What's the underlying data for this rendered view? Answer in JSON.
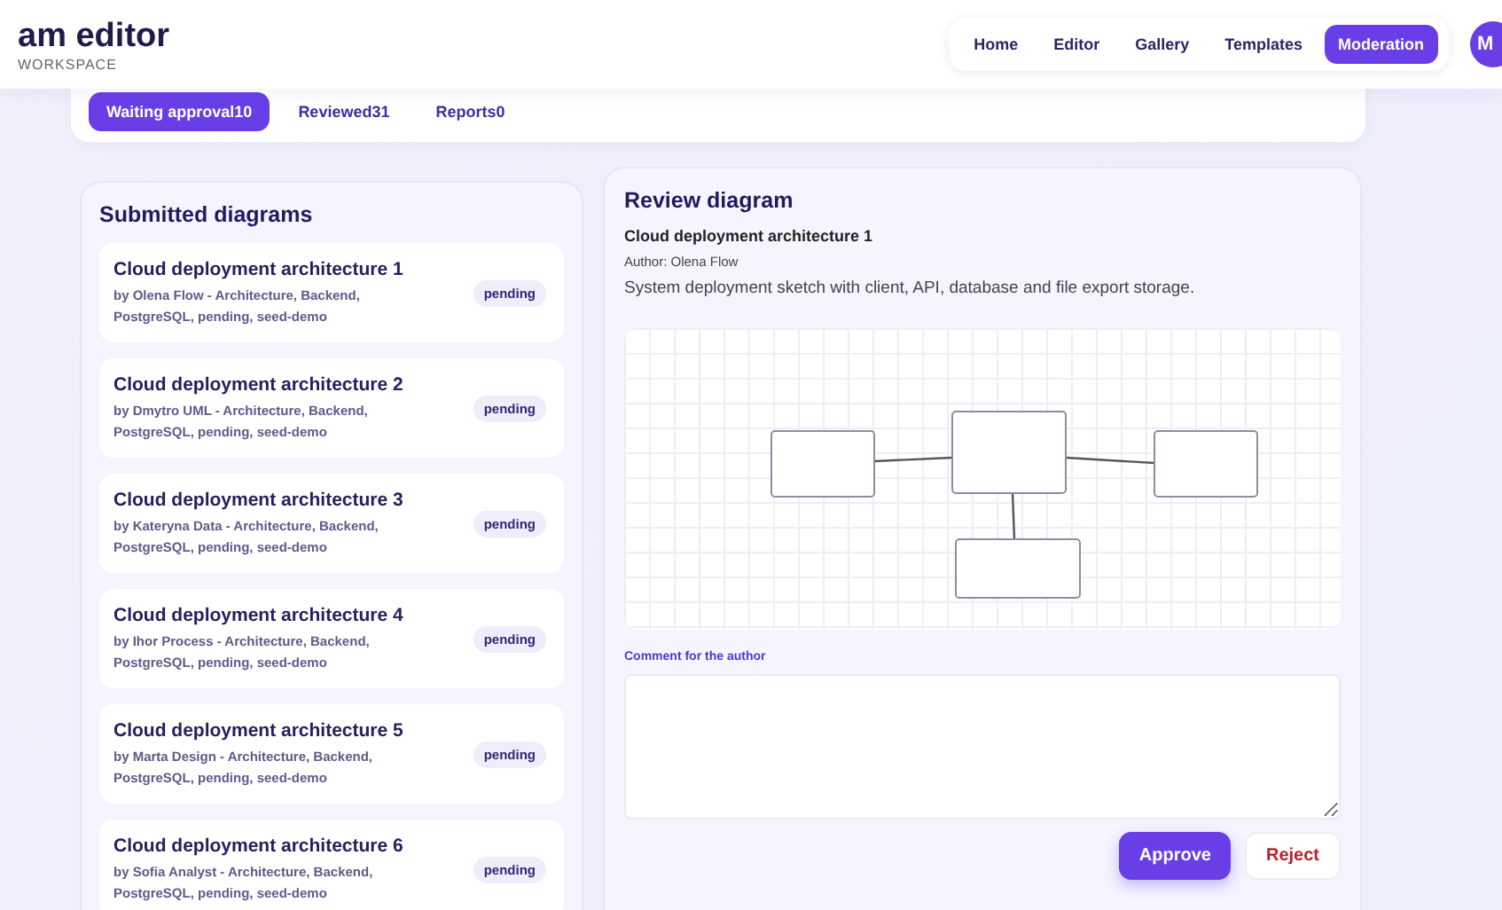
{
  "brand": {
    "title": "am editor",
    "subtitle": "WORKSPACE"
  },
  "nav": [
    {
      "label": "Home",
      "selected": false
    },
    {
      "label": "Editor",
      "selected": false
    },
    {
      "label": "Gallery",
      "selected": false
    },
    {
      "label": "Templates",
      "selected": false
    },
    {
      "label": "Moderation",
      "selected": true
    }
  ],
  "avatar": "M",
  "tabs": [
    {
      "label": "Waiting approval",
      "count": "10",
      "selected": true
    },
    {
      "label": "Reviewed",
      "count": "31",
      "selected": false
    },
    {
      "label": "Reports",
      "count": "0",
      "selected": false
    }
  ],
  "submitted": {
    "title": "Submitted diagrams",
    "items": [
      {
        "title": "Cloud deployment architecture 1",
        "meta": "by Olena Flow - Architecture, Backend, PostgreSQL, pending, seed-demo",
        "status": "pending"
      },
      {
        "title": "Cloud deployment architecture 2",
        "meta": "by Dmytro UML - Architecture, Backend, PostgreSQL, pending, seed-demo",
        "status": "pending"
      },
      {
        "title": "Cloud deployment architecture 3",
        "meta": "by Kateryna Data - Architecture, Backend, PostgreSQL, pending, seed-demo",
        "status": "pending"
      },
      {
        "title": "Cloud deployment architecture 4",
        "meta": "by Ihor Process - Architecture, Backend, PostgreSQL, pending, seed-demo",
        "status": "pending"
      },
      {
        "title": "Cloud deployment architecture 5",
        "meta": "by Marta Design - Architecture, Backend, PostgreSQL, pending, seed-demo",
        "status": "pending"
      },
      {
        "title": "Cloud deployment architecture 6",
        "meta": "by Sofia Analyst - Architecture, Backend, PostgreSQL, pending, seed-demo",
        "status": "pending"
      }
    ]
  },
  "review": {
    "title": "Review diagram",
    "diagram_title": "Cloud deployment architecture 1",
    "author": "Author: Olena Flow",
    "description": "System deployment sketch with client, API, database and file export storage.",
    "comment_label": "Comment for the author",
    "buttons": [
      {
        "label": "Approve",
        "kind": "primary"
      },
      {
        "label": "Reject",
        "kind": "danger"
      }
    ]
  }
}
